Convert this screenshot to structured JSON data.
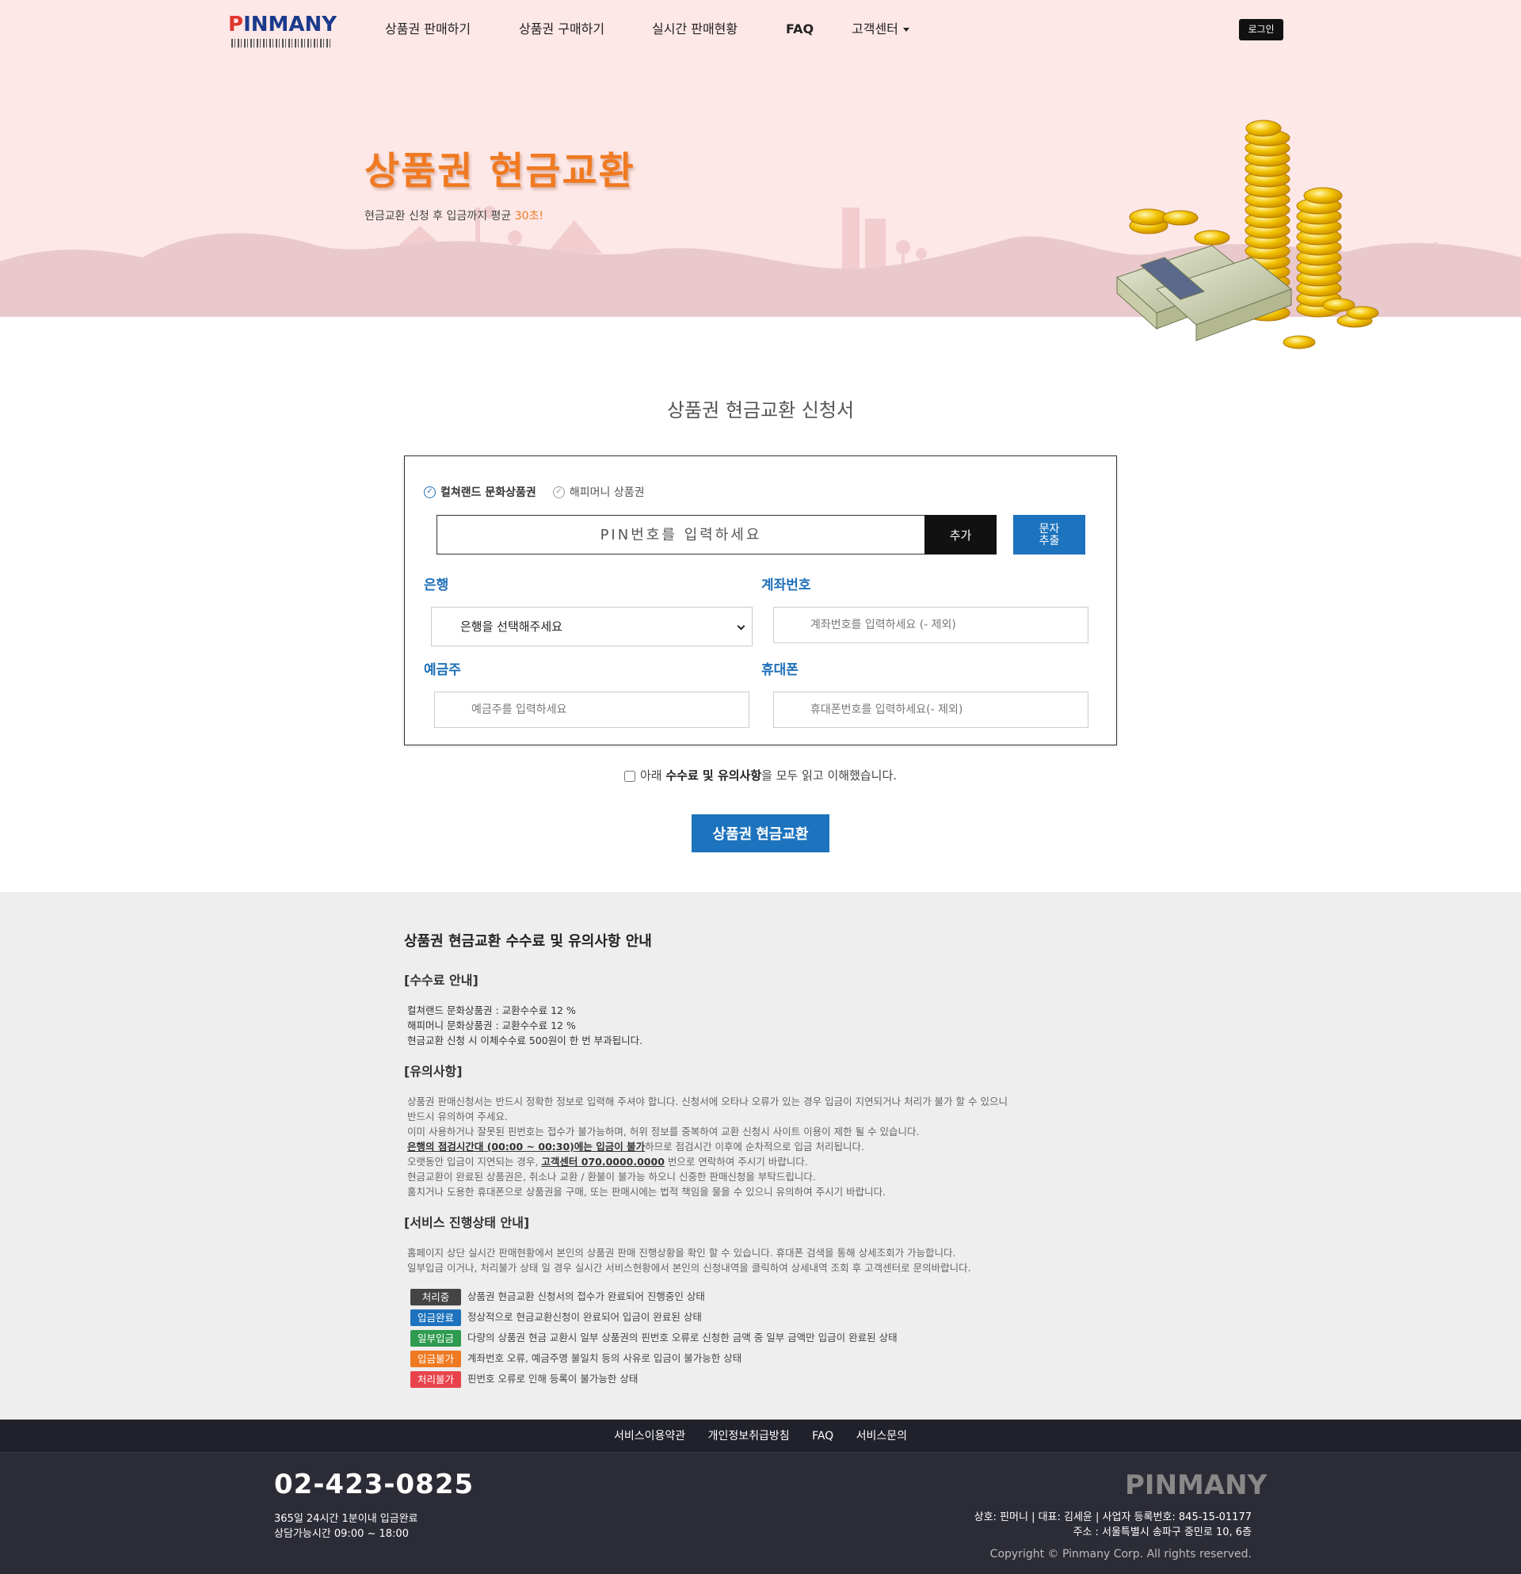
{
  "nav": {
    "logo": "PINMANY",
    "items": [
      "상품권 판매하기",
      "상품권 구매하기",
      "실시간 판매현황",
      "FAQ",
      "고객센터"
    ],
    "login": "로그인"
  },
  "hero": {
    "title": "상품권 현금교환",
    "subtitle": "현금교환 신청 후 입금까지 평균 ",
    "subtitle_accent": "30초!"
  },
  "form": {
    "title": "상품권 현금교환 신청서",
    "radio_1": "컬쳐랜드 문화상품권",
    "radio_2": "해피머니 상품권",
    "pin_placeholder": "PIN번호를 입력하세요",
    "add_label": "추가",
    "sms_label": "문자\n추출",
    "bank_label": "은행",
    "bank_select": "은행을 선택해주세요",
    "account_label": "계좌번호",
    "account_placeholder": "계좌번호를 입력하세요 (- 제외)",
    "holder_label": "예금주",
    "holder_placeholder": "예금주를 입력하세요",
    "phone_label": "휴대폰",
    "phone_placeholder": "휴대폰번호를 입력하세요(- 제외)",
    "agree_pre": "아래 ",
    "agree_strong": "수수료 및 유의사항",
    "agree_post": "을 모두 읽고 이해했습니다.",
    "submit": "상품권 현금교환"
  },
  "notice": {
    "title": "상품권 현금교환 수수료 및 유의사항 안내",
    "fee_title": "[수수료 안내]",
    "fee_lines": [
      "컬쳐랜드 문화상품권 : 교환수수료 12 %",
      "해피머니 문화상품권 : 교환수수료 12 %",
      "현금교환 신청 시 이체수수료 500원이 한 번 부과됩니다."
    ],
    "caution_title": "[유의사항]",
    "caution_1": "상품권 판매신청서는 반드시 정확한 정보로 입력해 주셔야 합니다. 신청서에 오타나 오류가 있는 경우 입금이 지연되거나 처리가 불가 할 수 있으니",
    "caution_2": "반드시 유의하여 주세요.",
    "caution_3": "이미 사용하거나 잘못된 핀번호는 접수가 불가능하며, 허위 정보를 중복하여 교환 신청시 사이트 이용이 제한 될 수 있습니다.",
    "caution_4_ul": "은행의 점검시간대 (00:00 ~ 00:30)에는 입금이 불가",
    "caution_4_rest": "하므로 점검시간 이후에 순차적으로 입금 처리됩니다.",
    "caution_5_pre": "오랫동안 입금이 지연되는 경우, ",
    "caution_5_ul": "고객센터 070.0000.0000",
    "caution_5_post": " 번으로 연락하여 주시기 바랍니다.",
    "caution_6": "현금교환이 완료된 상품권은, 취소나 교환 / 환불이 불가능 하오니 신중한 판매신청을 부탁드립니다.",
    "caution_7": "훔치거나 도용한 휴대폰으로 상품권을 구매, 또는 판매시에는 법적 책임을 물을 수 있으니 유의하여 주시기 바랍니다.",
    "service_title": "[서비스 진행상태 안내]",
    "service_1": "홈페이지 상단 실시간 판매현황에서 본인의 상품권 판매 진행상황을 확인 할 수 있습니다. 휴대폰 검색을 통해 상세조회가 가능합니다.",
    "service_2": "일부입금 이거나, 처리불가 상태 일 경우 실시간 서비스현황에서 본인의 신청내역을 클릭하여 상세내역 조회 후 고객센터로 문의바랍니다.",
    "statuses": [
      {
        "badge": "처리중",
        "color": "#444444",
        "desc": "상품권 현금교환 신청서의 접수가 완료되어 진행중인 상태"
      },
      {
        "badge": "입금완료",
        "color": "#1d73be",
        "desc": "정상적으로 현금교환신청이 완료되어 입금이 완료된 상태"
      },
      {
        "badge": "일부입금",
        "color": "#2e9b4f",
        "desc": "다량의 상품권 현금 교환시 일부 상품권의 핀번호 오류로 신청한 금액 중 일부 금액만 입금이 완료된 상태"
      },
      {
        "badge": "입금불가",
        "color": "#f07a22",
        "desc": "계좌번호 오류, 예금주명 불일치 등의 사유로 입금이 불가능한 상태"
      },
      {
        "badge": "처리불가",
        "color": "#e8434b",
        "desc": "핀번호 오류로 인해 등록이 불가능한 상태"
      }
    ]
  },
  "footer": {
    "links": [
      "서비스이용약관",
      "개인정보취급방침",
      "FAQ",
      "서비스문의"
    ],
    "phone": "02-423-0825",
    "hours_1": "365일 24시간 1분이내 입금완료",
    "hours_2": "상담가능시간 09:00 ~ 18:00",
    "logo": "PINMANY",
    "info_1": "상호: 핀머니 | 대표: 김세윤 | 사업자 등록번호: 845-15-01177",
    "info_2": "주소 : 서울특별시 송파구 중민로 10, 6층",
    "copyright": "Copyright © Pinmany Corp. All rights reserved."
  },
  "colors": {
    "hero_bg": "#fde7e7",
    "accent_orange": "#f07a22",
    "primary_blue": "#1d73be",
    "notice_bg": "#eeeeee",
    "footer_bg": "#2b2c36"
  }
}
